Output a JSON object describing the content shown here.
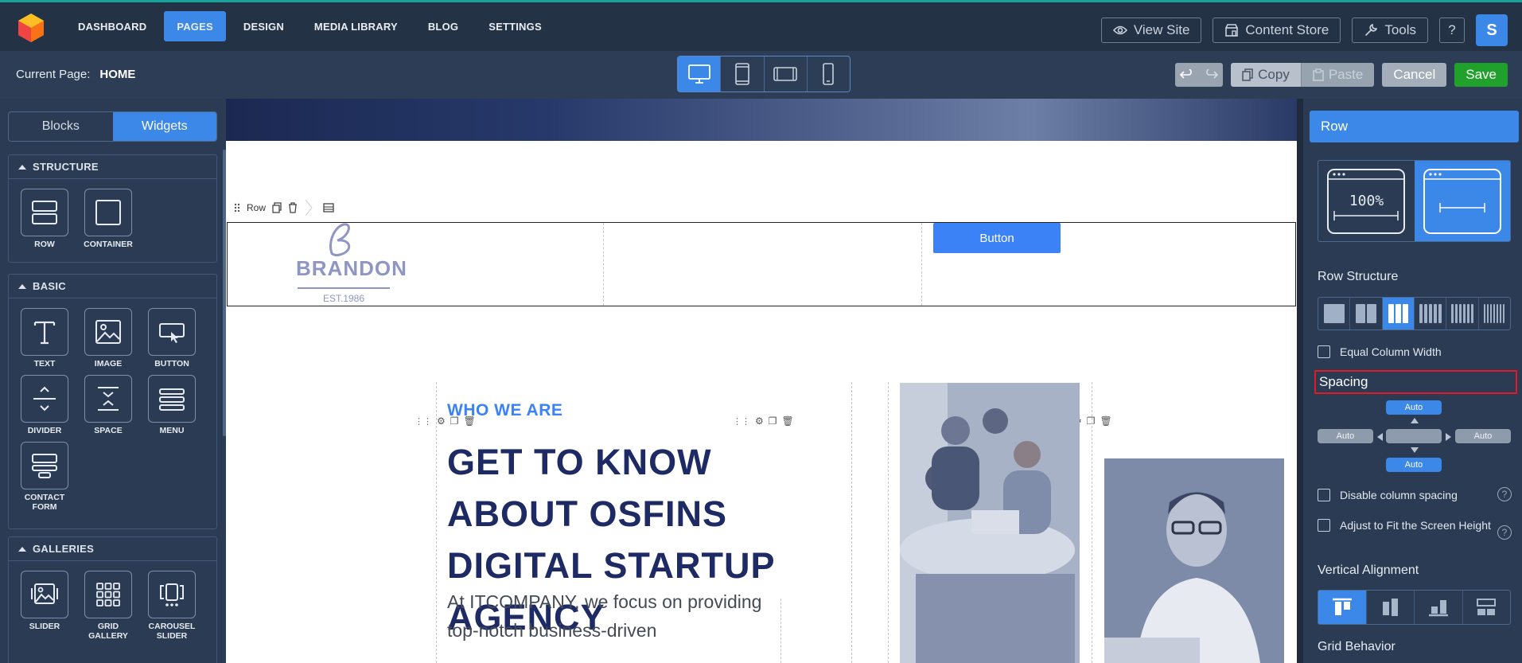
{
  "topnav": {
    "items": [
      {
        "label": "DASHBOARD"
      },
      {
        "label": "PAGES"
      },
      {
        "label": "DESIGN"
      },
      {
        "label": "MEDIA LIBRARY"
      },
      {
        "label": "BLOG"
      },
      {
        "label": "SETTINGS"
      }
    ],
    "active": "PAGES",
    "view_site": "View Site",
    "content_store": "Content Store",
    "tools": "Tools",
    "help": "?",
    "avatar_initial": "S"
  },
  "subbar": {
    "current_page_label": "Current Page:",
    "current_page_value": "HOME",
    "devices": [
      "desktop",
      "tablet-portrait",
      "tablet-landscape",
      "mobile"
    ],
    "active_device": "desktop",
    "copy": "Copy",
    "paste": "Paste",
    "cancel": "Cancel",
    "save": "Save"
  },
  "left_sidebar": {
    "tabs": [
      {
        "label": "Blocks"
      },
      {
        "label": "Widgets"
      }
    ],
    "active_tab": "Widgets",
    "sections": [
      {
        "title": "STRUCTURE",
        "widgets": [
          {
            "label": "ROW"
          },
          {
            "label": "CONTAINER"
          }
        ]
      },
      {
        "title": "BASIC",
        "widgets": [
          {
            "label": "TEXT"
          },
          {
            "label": "IMAGE"
          },
          {
            "label": "BUTTON"
          },
          {
            "label": "DIVIDER"
          },
          {
            "label": "SPACE"
          },
          {
            "label": "MENU"
          },
          {
            "label": "CONTACT FORM"
          }
        ]
      },
      {
        "title": "GALLERIES",
        "widgets": [
          {
            "label": "SLIDER"
          },
          {
            "label": "GRID GALLERY"
          },
          {
            "label": "CAROUSEL SLIDER"
          }
        ]
      }
    ]
  },
  "canvas": {
    "row_toolbar_label": "Row",
    "brand_name": "BRANDON",
    "brand_sub": "EST.1986",
    "button_label": "Button",
    "who_we_are": "WHO WE ARE",
    "headline": "GET TO KNOW ABOUT OSFINS DIGITAL STARTUP AGENCY",
    "paragraph": "At ITCOMPANY, we focus on providing top-notch business-driven"
  },
  "right_sidebar": {
    "title": "Row",
    "layout_full_label": "100%",
    "row_structure_label": "Row Structure",
    "equal_column_width": "Equal Column Width",
    "spacing_label": "Spacing",
    "spacing_top": "Auto",
    "spacing_left": "Auto",
    "spacing_right": "Auto",
    "spacing_bottom": "Auto",
    "disable_column_spacing": "Disable column spacing",
    "adjust_fit": "Adjust to Fit the Screen Height",
    "vertical_alignment_label": "Vertical Alignment",
    "grid_behavior_label": "Grid Behavior"
  },
  "colors": {
    "accent": "#3b88e8",
    "save": "#1fa12c",
    "highlight_border": "#e01b24",
    "headline": "#1e2a63"
  }
}
